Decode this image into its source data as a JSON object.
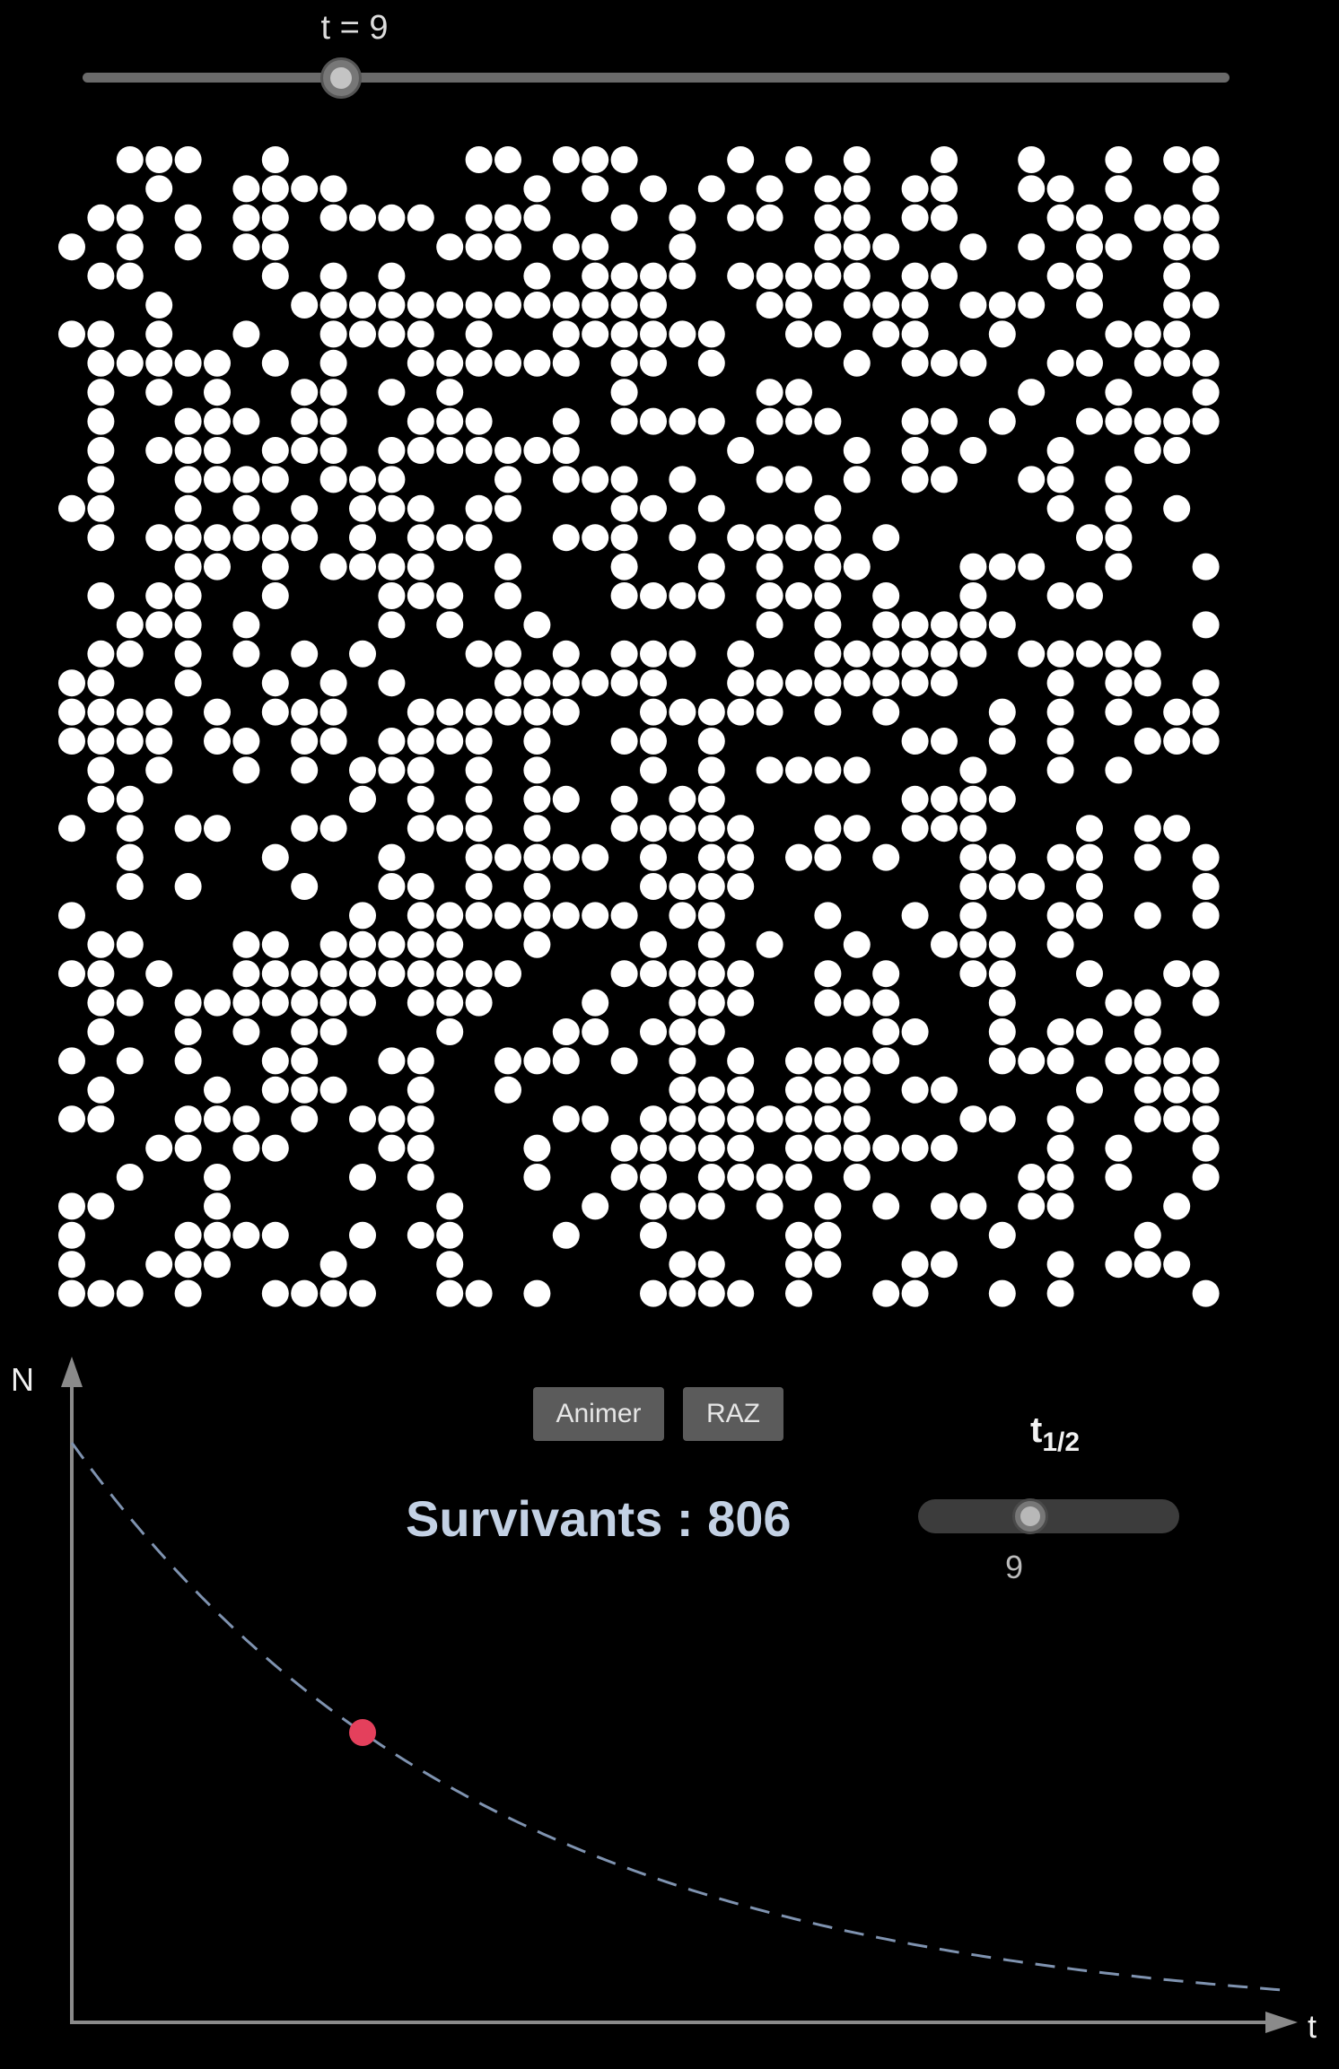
{
  "time_slider": {
    "label": "t = 9",
    "value": 9,
    "min": 0,
    "max": 40
  },
  "grid": {
    "rows": 40,
    "cols": 40,
    "survivors": 806
  },
  "controls": {
    "animate_label": "Animer",
    "reset_label": "RAZ"
  },
  "survivants_text": "Survivants : 806",
  "half_life": {
    "label_main": "t",
    "label_sub": "1/2",
    "value": 9,
    "value_text": "9",
    "min": 1,
    "max": 20
  },
  "graph": {
    "y_axis_label": "N",
    "x_axis_label": "t",
    "curve_color": "#7f93b0",
    "point_color": "#e4405c"
  },
  "colors": {
    "background": "#000000",
    "particle": "#ffffff",
    "accent_text": "#c3d1e4"
  }
}
